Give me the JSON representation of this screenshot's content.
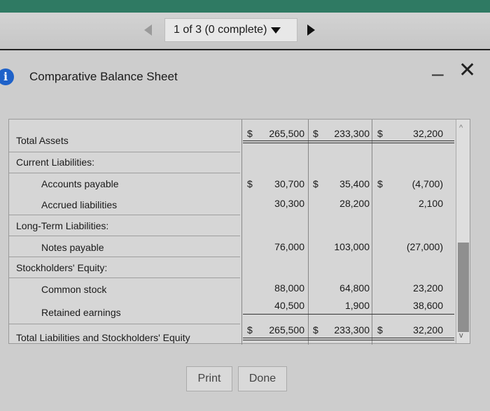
{
  "pager": {
    "status": "1 of 3 (0 complete)"
  },
  "dialog": {
    "title": "Comparative Balance Sheet"
  },
  "table": {
    "rows": [
      {
        "label": "Total Assets",
        "c1": "265,500",
        "c2": "233,300",
        "c3": "32,200"
      },
      {
        "label": "Current Liabilities:"
      },
      {
        "label": "Accounts payable",
        "c1": "30,700",
        "c2": "35,400",
        "c3": "(4,700)"
      },
      {
        "label": "Accrued liabilities",
        "c1": "30,300",
        "c2": "28,200",
        "c3": "2,100"
      },
      {
        "label": "Long-Term Liabilities:"
      },
      {
        "label": "Notes payable",
        "c1": "76,000",
        "c2": "103,000",
        "c3": "(27,000)"
      },
      {
        "label": "Stockholders' Equity:"
      },
      {
        "label": "Common stock",
        "c1": "88,000",
        "c2": "64,800",
        "c3": "23,200"
      },
      {
        "label": "Retained earnings",
        "c1": "40,500",
        "c2": "1,900",
        "c3": "38,600"
      },
      {
        "label": "Total Liabilities and Stockholders' Equity",
        "c1": "265,500",
        "c2": "233,300",
        "c3": "32,200"
      }
    ],
    "currency_symbol": "$"
  },
  "buttons": {
    "print": "Print",
    "done": "Done"
  },
  "colors": {
    "top_strip": "#2f7a63",
    "info_icon": "#1f62c9"
  },
  "icons": [
    "info-icon",
    "minimize-icon",
    "close-icon",
    "prev-arrow-icon",
    "next-arrow-icon",
    "dropdown-caret-icon"
  ]
}
